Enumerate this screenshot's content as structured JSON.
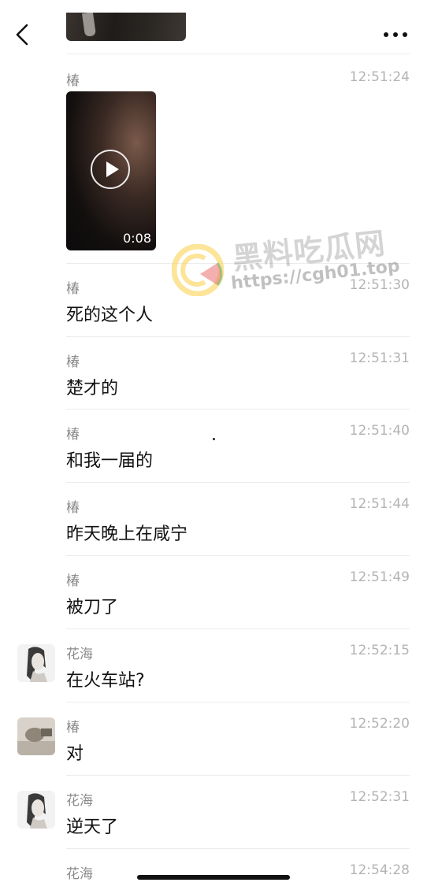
{
  "header": {
    "back_icon": "chevron-left-icon",
    "more_icon": "more-dots-icon"
  },
  "video": {
    "sender": "椿",
    "time": "12:51:24",
    "duration": "0:08",
    "play_icon": "play-icon"
  },
  "watermark": {
    "brand": "黑料吃瓜网",
    "url": "https://cgh01.top"
  },
  "messages": [
    {
      "sender": "椿",
      "time": "12:51:30",
      "text": "死的这个人"
    },
    {
      "sender": "椿",
      "time": "12:51:31",
      "text": "楚才的"
    },
    {
      "sender": "椿",
      "time": "12:51:40",
      "text": "和我一届的"
    },
    {
      "sender": "椿",
      "time": "12:51:44",
      "text": "昨天晚上在咸宁"
    },
    {
      "sender": "椿",
      "time": "12:51:49",
      "text": "被刀了"
    },
    {
      "sender": "花海",
      "time": "12:52:15",
      "text": "在火车站?"
    },
    {
      "sender": "椿",
      "time": "12:52:20",
      "text": "对"
    },
    {
      "sender": "花海",
      "time": "12:52:31",
      "text": "逆天了"
    },
    {
      "sender": "花海",
      "time": "12:54:28",
      "text": ""
    }
  ]
}
